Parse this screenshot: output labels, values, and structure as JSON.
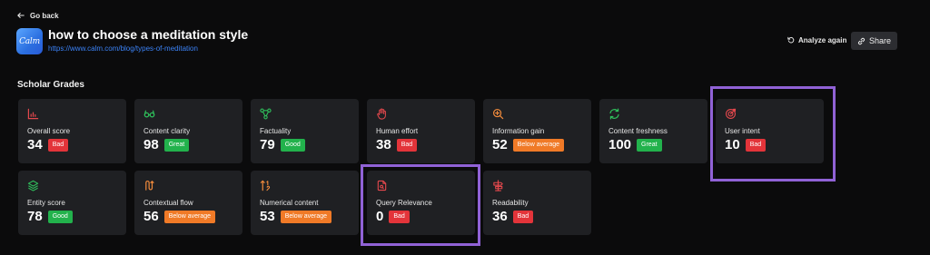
{
  "nav": {
    "back_label": "Go back"
  },
  "header": {
    "logo_text": "Calm",
    "title": "how to choose a meditation style",
    "url": "https://www.calm.com/blog/types-of-meditation",
    "analyze_label": "Analyze again",
    "share_label": "Share"
  },
  "section": {
    "title": "Scholar Grades"
  },
  "grades": [
    {
      "label": "Overall score",
      "value": "34",
      "badge": "Bad"
    },
    {
      "label": "Content clarity",
      "value": "98",
      "badge": "Great"
    },
    {
      "label": "Factuality",
      "value": "79",
      "badge": "Good"
    },
    {
      "label": "Human effort",
      "value": "38",
      "badge": "Bad"
    },
    {
      "label": "Information gain",
      "value": "52",
      "badge": "Below average"
    },
    {
      "label": "Content freshness",
      "value": "100",
      "badge": "Great"
    },
    {
      "label": "User intent",
      "value": "10",
      "badge": "Bad"
    },
    {
      "label": "Entity score",
      "value": "78",
      "badge": "Good"
    },
    {
      "label": "Contextual flow",
      "value": "56",
      "badge": "Below average"
    },
    {
      "label": "Numerical content",
      "value": "53",
      "badge": "Below average"
    },
    {
      "label": "Query Relevance",
      "value": "0",
      "badge": "Bad"
    },
    {
      "label": "Readability",
      "value": "36",
      "badge": "Bad"
    }
  ],
  "colors": {
    "bad": "#e3343a",
    "good": "#22b24c",
    "great": "#22b24c",
    "below_average": "#f07a27",
    "highlight": "#9062d6",
    "link": "#3b82f6",
    "icon_red": "#e5484d",
    "icon_green": "#2fbf5b",
    "icon_orange": "#f08a3c"
  }
}
